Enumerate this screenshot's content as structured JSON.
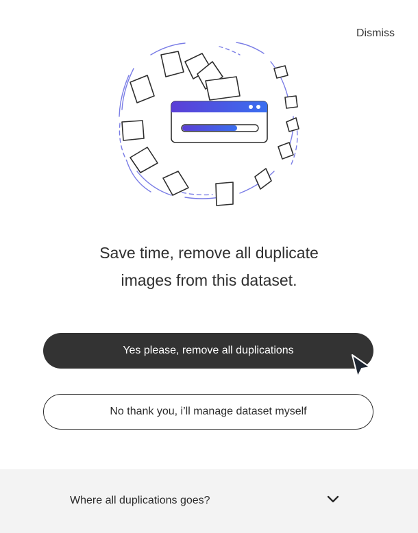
{
  "dialog": {
    "dismiss_label": "Dismiss",
    "headline_line1": "Save time, remove all duplicate",
    "headline_line2": "images from this dataset.",
    "primary_button_label": "Yes please, remove all duplications",
    "secondary_button_label": "No thank you, i’ll manage dataset myself",
    "faq_label": "Where all duplications goes?"
  },
  "illustration": {
    "accent_gradient_start": "#5b3fd6",
    "accent_gradient_end": "#3a6ff0",
    "orbit_color": "#7a7de6",
    "outline_color": "#2e2e2e"
  },
  "icons": {
    "faq_chevron": "chevron-down-icon",
    "cursor": "mouse-pointer-icon"
  }
}
